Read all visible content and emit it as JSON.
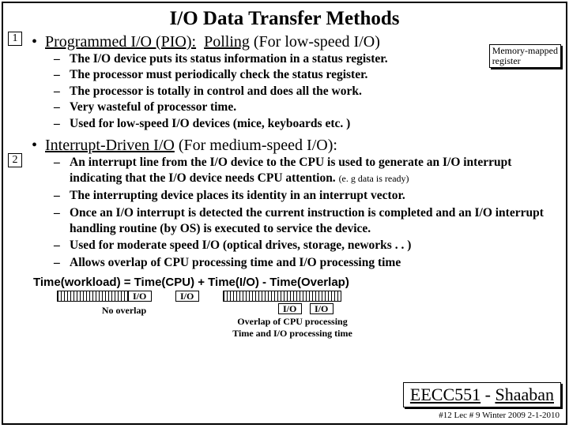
{
  "title": "I/O Data Transfer Methods",
  "box1": "1",
  "box2": "2",
  "sec1": {
    "label_pio": "Programmed I/O (PIO):",
    "label_poll": "Polling",
    "tail": "(For low-speed I/O)"
  },
  "s1": {
    "a": "The I/O device puts its status information in a status register.",
    "b": "The processor must periodically check the status register.",
    "c": "The processor is totally in control and does all the work.",
    "d": "Very wasteful of processor time.",
    "e": "Used for low-speed I/O devices (mice, keyboards etc. )"
  },
  "callout": "Memory-mapped\nregister",
  "sec2": {
    "label": "Interrupt-Driven I/O",
    "tail": "(For medium-speed I/O):"
  },
  "s2": {
    "a": "An interrupt line from the I/O device to the CPU is used to generate an I/O interrupt indicating  that the I/O device needs CPU attention.",
    "a2": "(e. g data is ready)",
    "b": "The interrupting device places its identity in an interrupt vector.",
    "c": "Once an I/O interrupt is detected the current instruction is completed and an I/O interrupt handling routine (by OS)  is executed to service the device.",
    "d": "Used for moderate speed I/O  (optical drives, storage, neworks . . )",
    "e": "Allows overlap of CPU processing time and I/O processing time"
  },
  "formula": "Time(workload) = Time(CPU) + Time(I/O) - Time(Overlap)",
  "io": "I/O",
  "cap1": "No overlap",
  "cap2": "Overlap of CPU processing\nTime and I/O processing time",
  "footer": {
    "a": "EECC551",
    "dash": " - ",
    "b": "Shaaban"
  },
  "footnote": "#12   Lec # 9   Winter 2009  2-1-2010"
}
